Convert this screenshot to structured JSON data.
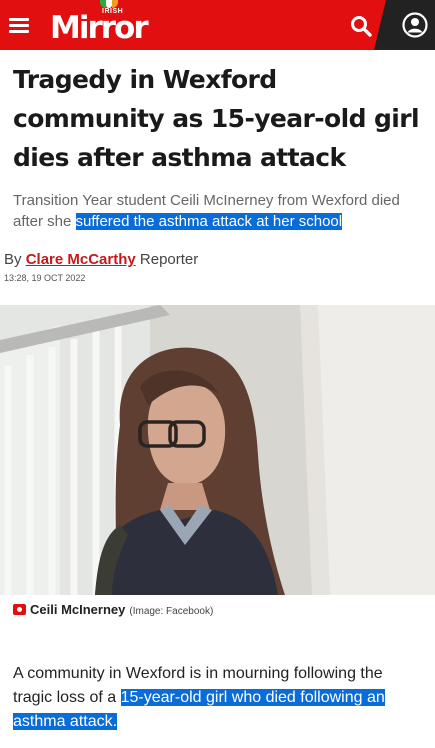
{
  "header": {
    "logo_small": "IRISH",
    "logo_main": "Mirror",
    "icons": [
      "menu-icon",
      "search-icon",
      "account-icon"
    ],
    "brand_color": "#e10f0f"
  },
  "article": {
    "headline": "Tragedy in Wexford community as 15-year-old girl dies after asthma attack",
    "standfirst_plain": "Transition Year student Ceili McInerney from Wexford died after she ",
    "standfirst_highlight": "suffered the asthma attack at her school",
    "byline_prefix": "By ",
    "author": "Clare McCarthy",
    "author_role": " Reporter",
    "timestamp": "13:28, 19 OCT 2022",
    "caption_name": "Ceili McInerney",
    "caption_credit": "(Image: Facebook)",
    "body_plain": "A community in Wexford is in mourning following the tragic loss of a ",
    "body_highlight": "15-year-old girl who died following an asthma attack."
  },
  "colors": {
    "highlight": "#0a6cd6",
    "author_link": "#c61a1a"
  }
}
